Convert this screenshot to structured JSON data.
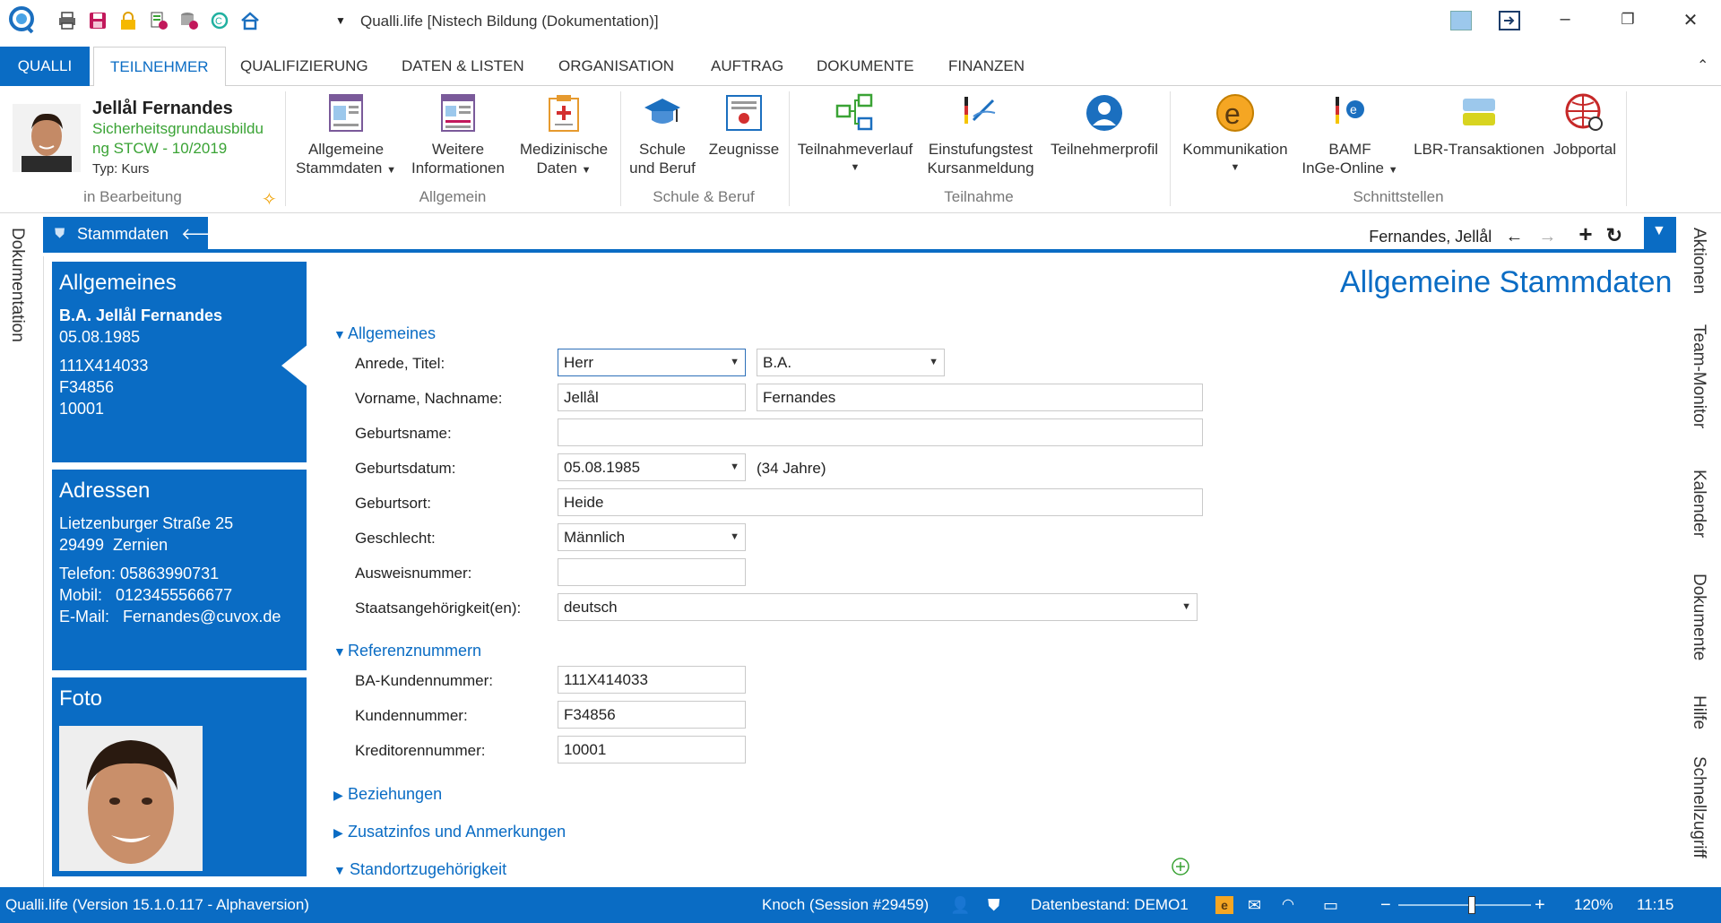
{
  "window": {
    "title": "Qualli.life [Nistech Bildung (Dokumentation)]",
    "minimize": "–",
    "restore": "❐",
    "close": "✕"
  },
  "menu": {
    "brand": "QUALLI",
    "tabs": [
      "TEILNEHMER",
      "QUALIFIZIERUNG",
      "DATEN & LISTEN",
      "ORGANISATION",
      "AUFTRAG",
      "DOKUMENTE",
      "FINANZEN"
    ],
    "collapse": "⌃"
  },
  "profile": {
    "name": "Jellål Fernandes",
    "course_line1": "Sicherheitsgrundausbildu",
    "course_line2": "ng STCW - 10/2019",
    "type": "Typ: Kurs",
    "status": "in Bearbeitung"
  },
  "ribbon": {
    "allgemein": {
      "label": "Allgemein",
      "stammdaten": [
        "Allgemeine",
        "Stammdaten"
      ],
      "weitere": [
        "Weitere",
        "Informationen"
      ],
      "medizin": [
        "Medizinische",
        "Daten"
      ]
    },
    "schule": {
      "label": "Schule & Beruf",
      "schule": [
        "Schule",
        "und Beruf"
      ],
      "zeugnisse": "Zeugnisse"
    },
    "teilnahme": {
      "label": "Teilnahme",
      "verlauf": "Teilnahmeverlauf",
      "einstufung": [
        "Einstufungstest",
        "Kursanmeldung"
      ],
      "profil": "Teilnehmerprofil"
    },
    "schnittstellen": {
      "label": "Schnittstellen",
      "kommunikation": "Kommunikation",
      "bamf": [
        "BAMF",
        "InGe-Online"
      ],
      "lbr": "LBR-Transaktionen",
      "jobportal": "Jobportal"
    }
  },
  "sidebars": {
    "left": "Dokumentation",
    "right": [
      "Aktionen",
      "Team-Monitor",
      "Kalender",
      "Dokumente",
      "Hilfe",
      "Schnellzugriff"
    ]
  },
  "doctab": {
    "label": "Stammdaten",
    "back": "🡐",
    "person": "Fernandes, Jellål",
    "nav_back": "←",
    "nav_fwd": "→",
    "add": "+",
    "refresh": "↻"
  },
  "cards": {
    "allgemeines": {
      "title": "Allgemeines",
      "name": "B.A. Jellål Fernandes",
      "dob": "05.08.1985",
      "ba": "111X414033",
      "kd": "F34856",
      "kred": "10001"
    },
    "adressen": {
      "title": "Adressen",
      "street": "Lietzenburger Straße 25",
      "city": "29499  Zernien",
      "tel": "Telefon: 05863990731",
      "mobil": "Mobil:   0123455566677",
      "email": "E-Mail:   Fernandes@cuvox.de"
    },
    "foto": {
      "title": "Foto"
    }
  },
  "form": {
    "page_title": "Allgemeine Stammdaten",
    "sections": {
      "allgemeines": "Allgemeines",
      "referenz": "Referenznummern",
      "beziehungen": "Beziehungen",
      "zusatz": "Zusatzinfos und Anmerkungen",
      "standort": "Standortzugehörigkeit"
    },
    "labels": {
      "anrede": "Anrede, Titel:",
      "name": "Vorname, Nachname:",
      "geburtsname": "Geburtsname:",
      "geburtsdatum": "Geburtsdatum:",
      "geburtsort": "Geburtsort:",
      "geschlecht": "Geschlecht:",
      "ausweis": "Ausweisnummer:",
      "staat": "Staatsangehörigkeit(en):",
      "ba": "BA-Kundennummer:",
      "kunde": "Kundennummer:",
      "kreditor": "Kreditorennummer:"
    },
    "values": {
      "anrede": "Herr",
      "titel": "B.A.",
      "vorname": "Jellål",
      "nachname": "Fernandes",
      "geburtsname": "",
      "geburtsdatum": "05.08.1985",
      "alter": "(34 Jahre)",
      "geburtsort": "Heide",
      "geschlecht": "Männlich",
      "ausweis": "",
      "staat": "deutsch",
      "ba": "111X414033",
      "kunde": "F34856",
      "kreditor": "10001"
    }
  },
  "status": {
    "version": "Qualli.life (Version 15.1.0.117 - Alphaversion)",
    "session": "Knoch (Session #29459)",
    "datenbestand": "Datenbestand: DEMO1",
    "zoom": "120%",
    "time": "11:15"
  },
  "colors": {
    "accent": "#0a6cc4",
    "green_text": "#3aa335"
  }
}
